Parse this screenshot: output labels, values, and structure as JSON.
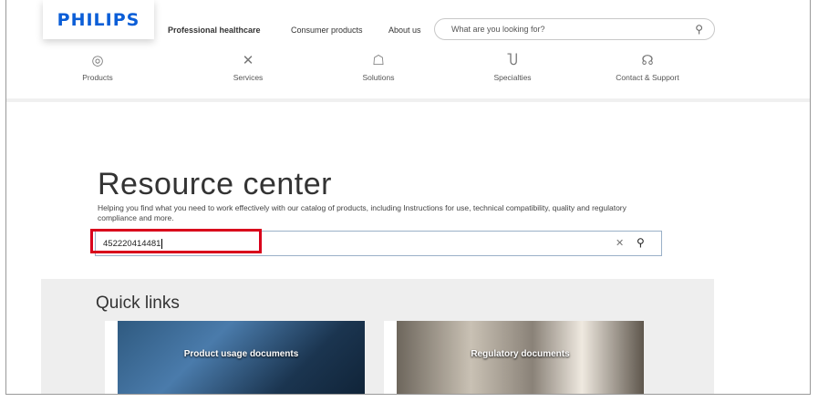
{
  "logo": {
    "text": "PHILIPS"
  },
  "topnav": {
    "items": [
      {
        "label": "Professional healthcare",
        "active": true
      },
      {
        "label": "Consumer products"
      },
      {
        "label": "About us"
      }
    ],
    "search_placeholder": "What are you looking for?",
    "search_icon": "search-icon"
  },
  "secnav": {
    "items": [
      {
        "label": "Products",
        "icon": "products-icon"
      },
      {
        "label": "Services",
        "icon": "services-icon"
      },
      {
        "label": "Solutions",
        "icon": "solutions-icon"
      },
      {
        "label": "Specialties",
        "icon": "stethoscope-icon"
      },
      {
        "label": "Contact & Support",
        "icon": "support-icon"
      }
    ]
  },
  "resource": {
    "title": "Resource center",
    "description": "Helping you find what you need to work effectively with our catalog of products, including Instructions for use, technical compatibility, quality and regulatory compliance and more.",
    "search_value": "452220414481",
    "clear_icon": "close-icon",
    "search_icon": "search-icon"
  },
  "quick_links": {
    "title": "Quick links",
    "cards": [
      {
        "label": "Product usage documents"
      },
      {
        "label": "Regulatory documents"
      }
    ]
  },
  "colors": {
    "brand": "#0b5ed7",
    "highlight": "#d9001b"
  }
}
